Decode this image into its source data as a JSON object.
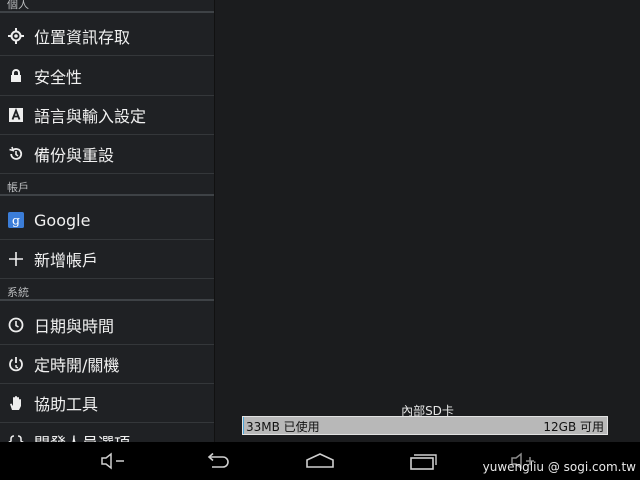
{
  "settings_list": {
    "personal_header": "個人",
    "accounts_header": "帳戶",
    "system_header": "系統",
    "items": [
      {
        "label": "位置資訊存取",
        "icon": "location-icon"
      },
      {
        "label": "安全性",
        "icon": "lock-icon"
      },
      {
        "label": "語言與輸入設定",
        "icon": "keyboard-a-icon"
      },
      {
        "label": "備份與重設",
        "icon": "backup-restore-icon"
      },
      {
        "label": "Google",
        "icon": "google-icon"
      },
      {
        "label": "新增帳戶",
        "icon": "plus-icon"
      },
      {
        "label": "日期與時間",
        "icon": "clock-icon"
      },
      {
        "label": "定時開/關機",
        "icon": "power-clock-icon"
      },
      {
        "label": "協助工具",
        "icon": "hand-icon"
      },
      {
        "label": "開發人員選項",
        "icon": "developer-braces-icon"
      }
    ]
  },
  "storage": {
    "title": "內部SD卡",
    "used_label": "33MB 已使用",
    "free_label": "12GB 可用",
    "used_fraction": 0.003
  },
  "navbar": {
    "buttons": [
      "volume-down-icon",
      "back-icon",
      "home-icon",
      "recent-apps-icon",
      "volume-up-icon"
    ]
  },
  "watermark": "yuwengliu  @ sogi.com.tw",
  "colors": {
    "sidebar_bg": "#1f2124",
    "content_bg": "#1b1c1e",
    "accent_blue": "#4aa3d6",
    "google_blue": "#3b7dd8"
  }
}
